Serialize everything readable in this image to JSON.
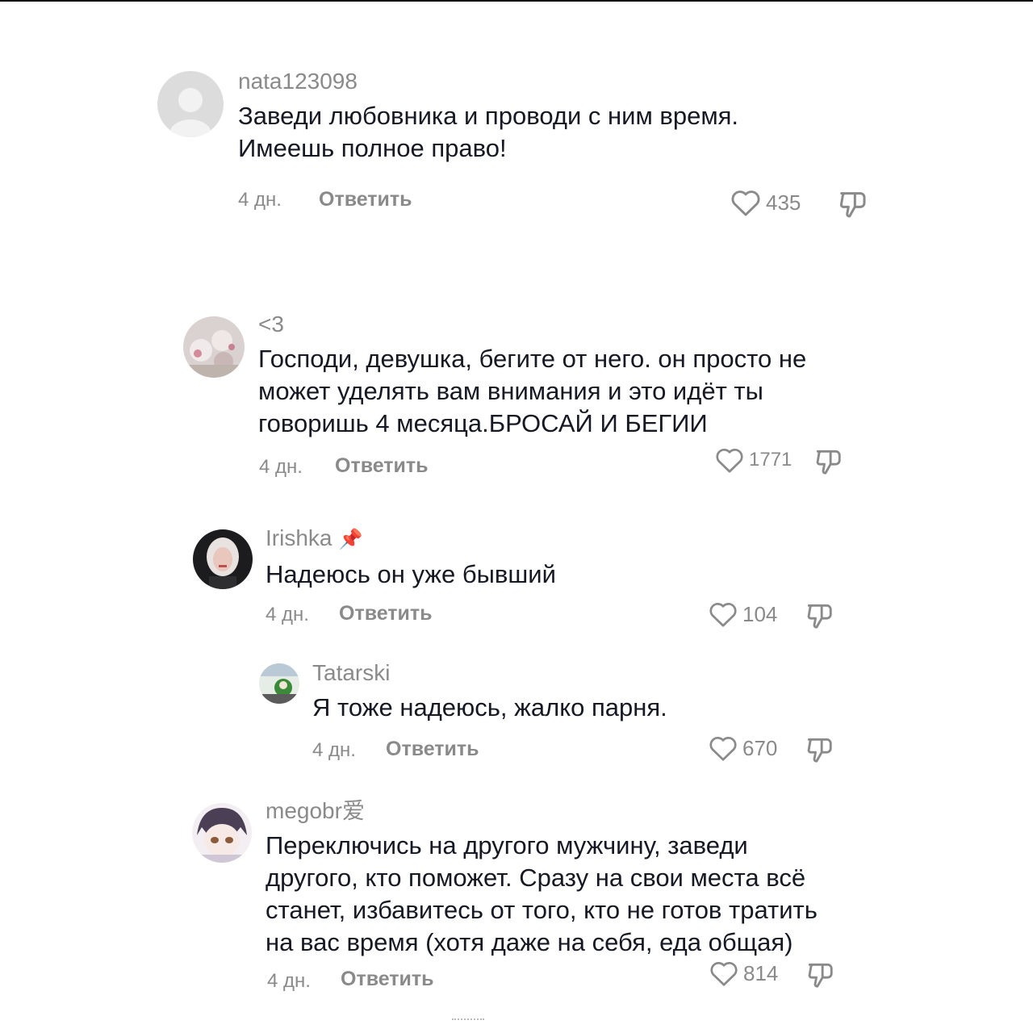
{
  "comments": [
    {
      "username": "nata123098",
      "pinned": false,
      "text_lines": [
        "Заведи любовника и проводи с ним время.",
        "Имеешь полное право!"
      ],
      "time": "4 дн.",
      "reply_label": "Ответить",
      "likes": "435",
      "avatar": "default-avatar-icon"
    },
    {
      "username": "<3",
      "pinned": false,
      "text_lines": [
        "Господи, девушка, бегите от него. он просто не",
        "может уделять вам внимания и это идёт ты",
        "говоришь 4 месяца.БРОСАЙ И БЕГИИ"
      ],
      "time": "4 дн.",
      "reply_label": "Ответить",
      "likes": "1771",
      "avatar": "photo-avatar"
    },
    {
      "username": "Irishka",
      "pinned": true,
      "text_lines": [
        "Надеюсь он уже бывший"
      ],
      "time": "4 дн.",
      "reply_label": "Ответить",
      "likes": "104",
      "avatar": "photo-avatar"
    },
    {
      "username": "Tatarski",
      "pinned": false,
      "text_lines": [
        "Я тоже надеюсь, жалко парня."
      ],
      "time": "4 дн.",
      "reply_label": "Ответить",
      "likes": "670",
      "avatar": "photo-avatar"
    },
    {
      "username": "megobr爱",
      "pinned": false,
      "text_lines": [
        "Переключись на другого мужчину, заведи",
        "другого, кто поможет. Сразу на свои места всё",
        "станет, избавитесь от того, кто не готов тратить",
        "на вас время (хотя даже на себя, еда общая)"
      ],
      "time": "4 дн.",
      "reply_label": "Ответить",
      "likes": "814",
      "avatar": "anime-avatar"
    }
  ],
  "icons": {
    "like": "heart-outline-icon",
    "dislike": "thumbs-down-icon",
    "pin": "pushpin-icon"
  },
  "colors": {
    "text": "#161823",
    "secondary": "#8a8a8a",
    "background": "#ffffff"
  }
}
